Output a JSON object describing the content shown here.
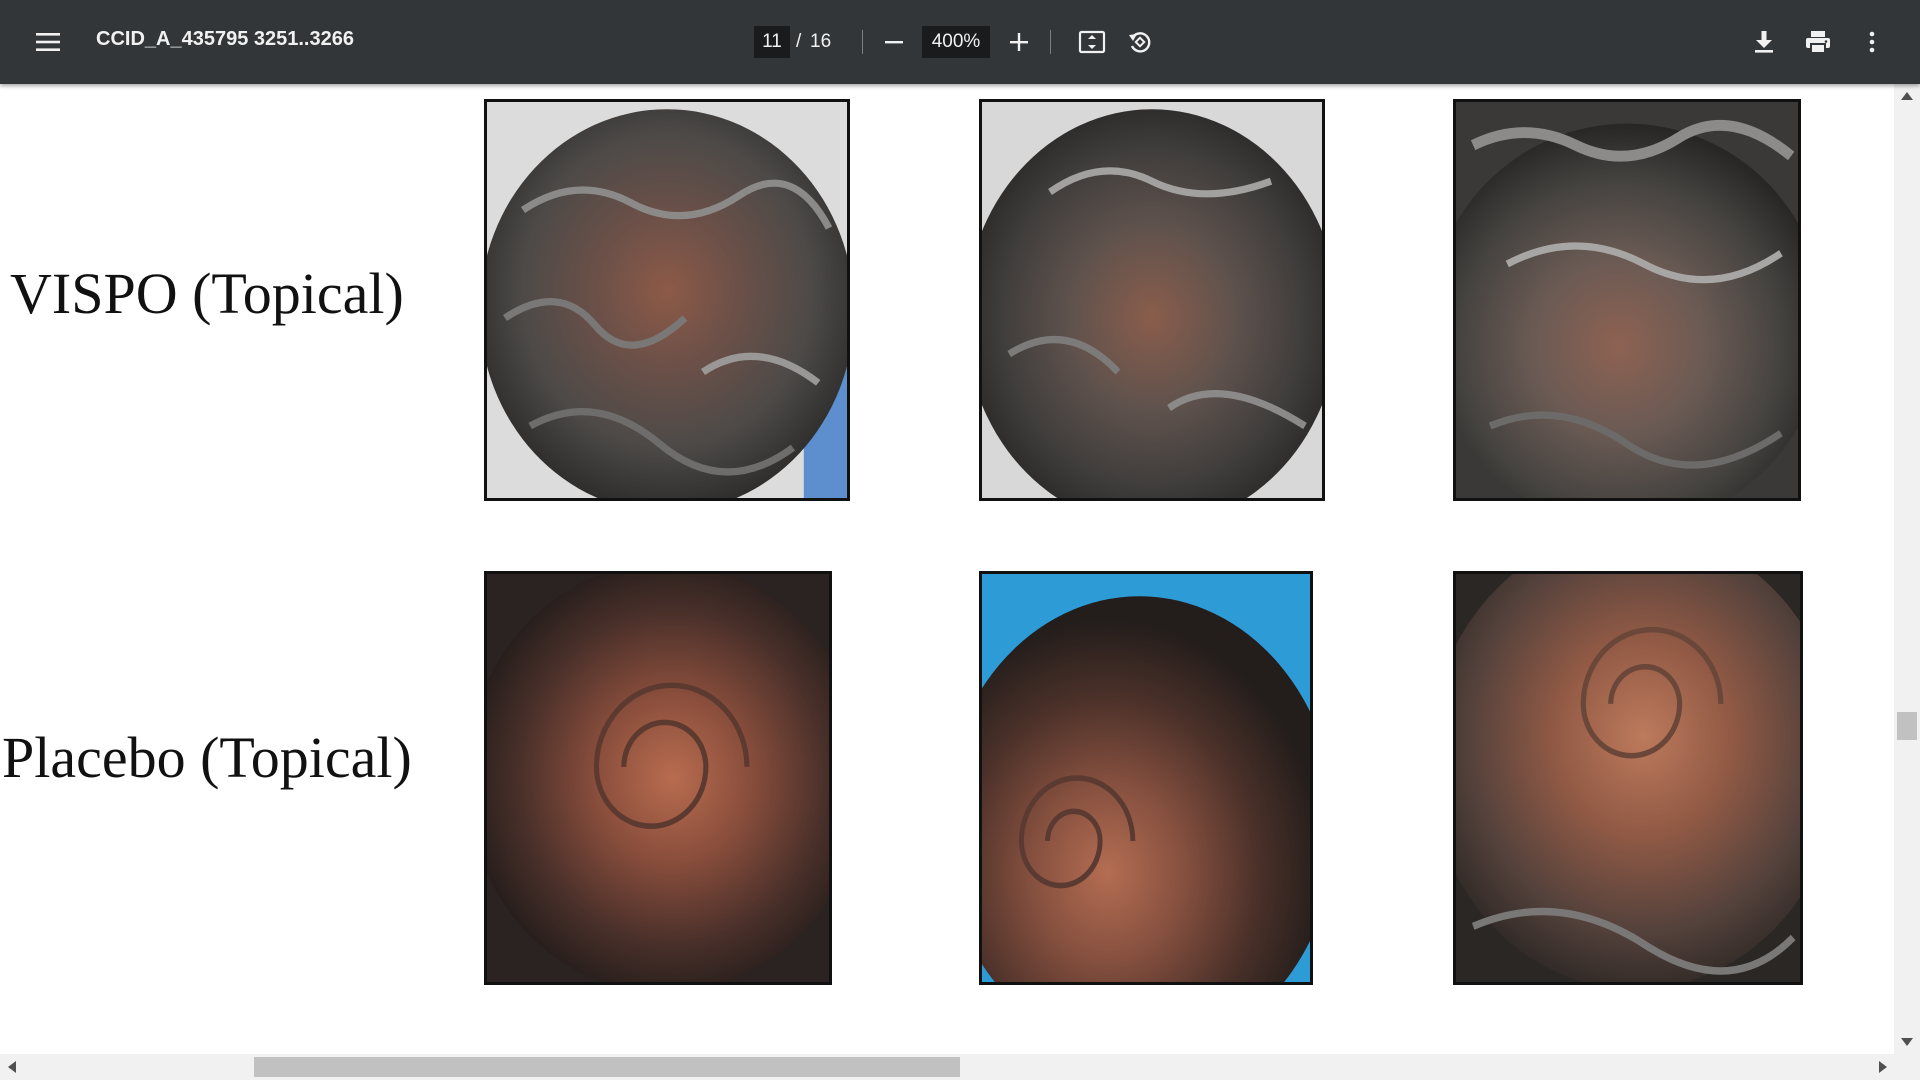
{
  "toolbar": {
    "title": "CCID_A_435795 3251..3266",
    "current_page": "11",
    "page_separator": "/",
    "total_pages": "16",
    "zoom": "400%",
    "icons": {
      "menu": "hamburger-menu-icon",
      "zoom_out": "minus-icon",
      "zoom_in": "plus-icon",
      "fit": "fit-to-page-icon",
      "rotate": "rotate-counterclockwise-icon",
      "download": "download-icon",
      "print": "print-icon",
      "more": "more-vertical-icon"
    }
  },
  "document": {
    "rows": [
      {
        "label": "VISPO (Topical)",
        "photo_count": 3
      },
      {
        "label": "Placebo (Topical)",
        "photo_count": 3
      }
    ]
  },
  "colors": {
    "toolbar_bg": "#323639",
    "input_bg": "#191b1c",
    "scrollbar_track": "#f1f1f1",
    "scrollbar_thumb": "#c1c1c1"
  }
}
